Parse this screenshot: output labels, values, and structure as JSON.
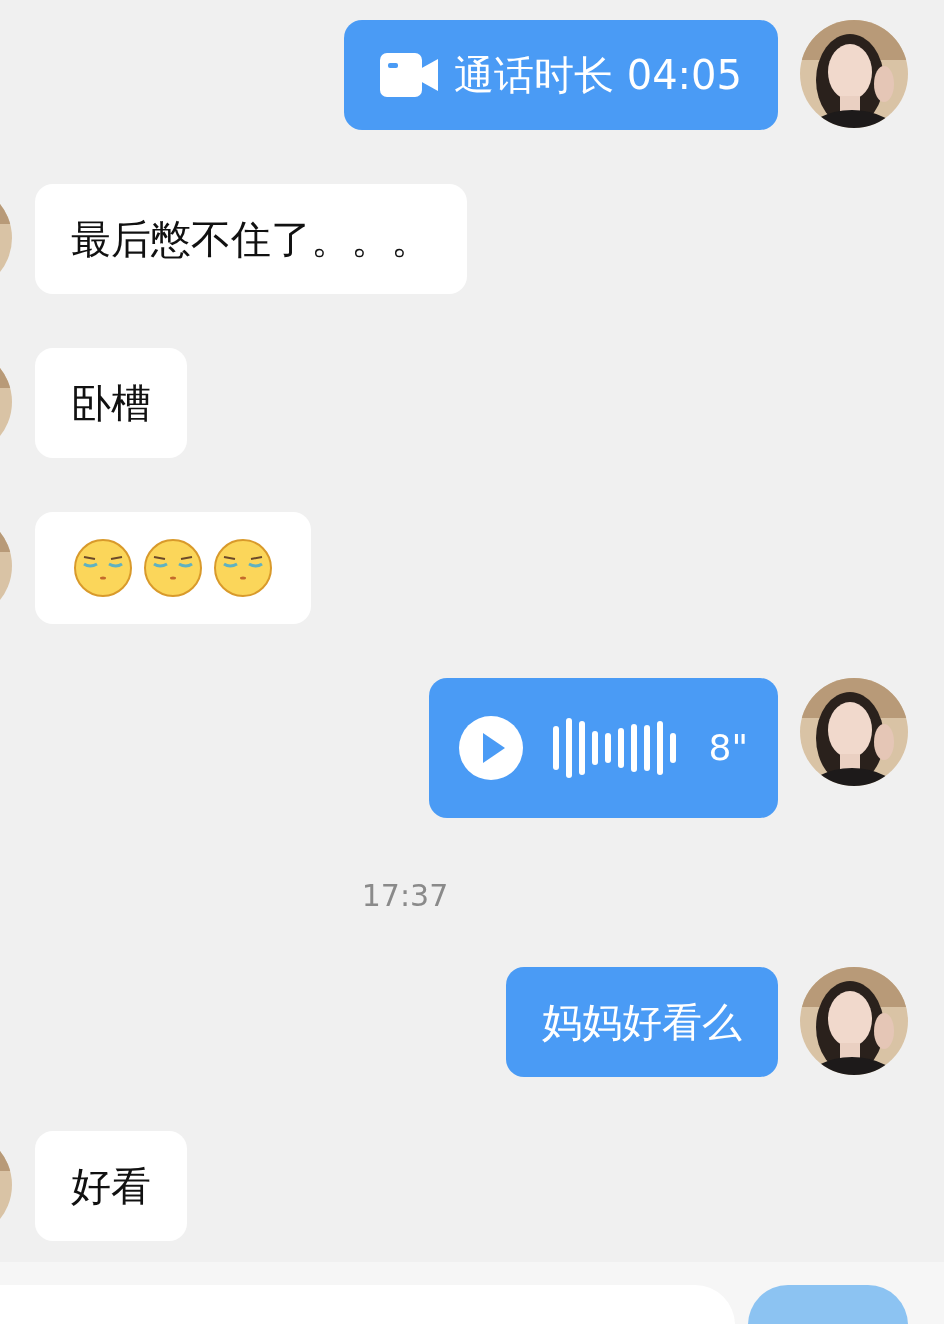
{
  "messages": [
    {
      "kind": "call",
      "outgoing": true,
      "text": "通话时长 04:05"
    },
    {
      "kind": "text",
      "outgoing": false,
      "text": "最后憋不住了。。。"
    },
    {
      "kind": "text",
      "outgoing": false,
      "text": "卧槽"
    },
    {
      "kind": "emoji",
      "outgoing": false,
      "emoji": [
        {
          "kind": "squint-face"
        },
        {
          "kind": "squint-face"
        },
        {
          "kind": "squint-face"
        }
      ]
    },
    {
      "kind": "voice",
      "outgoing": true,
      "duration": "8\""
    },
    {
      "kind": "time",
      "text": "17:37"
    },
    {
      "kind": "text",
      "outgoing": true,
      "text": "妈妈好看么"
    },
    {
      "kind": "text",
      "outgoing": false,
      "text": "好看"
    }
  ],
  "composer": {
    "send_button": {
      "kind": "button"
    }
  }
}
